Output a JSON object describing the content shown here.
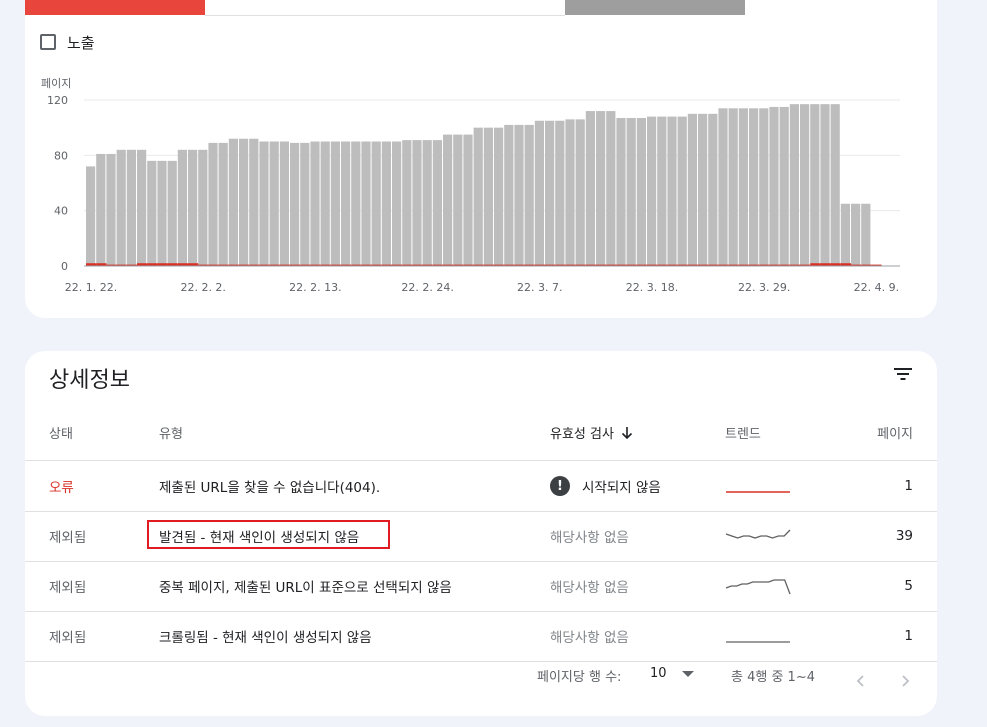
{
  "impressions_checkbox": {
    "label": "노출",
    "checked": false
  },
  "chart_data": {
    "type": "bar",
    "ylabel": "페이지",
    "ylim": [
      0,
      120
    ],
    "yticks": [
      "0",
      "40",
      "80",
      "120"
    ],
    "xtick_labels": [
      "22. 1. 22.",
      "22. 2. 2.",
      "22. 2. 13.",
      "22. 2. 24.",
      "22. 3. 7.",
      "22. 3. 18.",
      "22. 3. 29.",
      "22. 4. 9."
    ],
    "xtick_days": [
      0,
      11,
      22,
      33,
      44,
      55,
      66,
      77
    ],
    "series": [
      {
        "values": [
          72,
          81,
          81,
          84,
          84,
          84,
          76,
          76,
          76,
          84,
          84,
          84,
          89,
          89,
          92,
          92,
          92,
          90,
          90,
          90,
          89,
          89,
          90,
          90,
          90,
          90,
          90,
          90,
          90,
          90,
          90,
          91,
          91,
          91,
          91,
          95,
          95,
          95,
          100,
          100,
          100,
          102,
          102,
          102,
          105,
          105,
          105,
          106,
          106,
          112,
          112,
          112,
          107,
          107,
          107,
          108,
          108,
          108,
          108,
          110,
          110,
          110,
          114,
          114,
          114,
          114,
          114,
          115,
          115,
          117,
          117,
          117,
          117,
          117,
          45,
          45,
          45
        ]
      },
      {
        "values": [
          2,
          2,
          1,
          1,
          1,
          2,
          2,
          2,
          2,
          2,
          2,
          1,
          1,
          1,
          1,
          1,
          1,
          1,
          1,
          1,
          1,
          1,
          1,
          1,
          1,
          1,
          1,
          1,
          1,
          1,
          1,
          1,
          1,
          1,
          1,
          1,
          1,
          1,
          1,
          1,
          1,
          1,
          1,
          1,
          1,
          1,
          1,
          1,
          1,
          1,
          1,
          1,
          1,
          1,
          1,
          1,
          1,
          1,
          1,
          1,
          1,
          1,
          1,
          1,
          1,
          1,
          1,
          1,
          1,
          1,
          1,
          2,
          2,
          2,
          2,
          1,
          1,
          1
        ]
      }
    ],
    "colors": {
      "bar": "#bdbdbd",
      "error": "#d93025",
      "grid": "#e8eaed"
    }
  },
  "details": {
    "title": "상세정보",
    "headers": {
      "status": "상태",
      "type": "유형",
      "validation": "유효성 검사",
      "trend": "트렌드",
      "pages": "페이지"
    },
    "rows": [
      {
        "status": "오류",
        "type": "제출된 URL을 찾을 수 없습니다(404).",
        "validation": "시작되지 않음",
        "pages": "1",
        "trend": [
          1,
          1,
          1,
          1,
          1,
          1,
          1,
          1,
          1,
          1,
          1,
          1
        ],
        "trend_color": "#d93025"
      },
      {
        "status": "제외됨",
        "type": "발견됨 - 현재 색인이 생성되지 않음",
        "validation": "해당사항 없음",
        "pages": "39",
        "trend": [
          5,
          4,
          3,
          4,
          4,
          3,
          4,
          4,
          3,
          4,
          4,
          7
        ],
        "trend_color": "#616161"
      },
      {
        "status": "제외됨",
        "type": "중복 페이지, 제출된 URL이 표준으로 선택되지 않음",
        "validation": "해당사항 없음",
        "pages": "5",
        "trend": [
          3,
          4,
          4,
          5,
          5,
          6,
          6,
          6,
          6,
          7,
          7,
          7,
          0
        ],
        "trend_color": "#616161"
      },
      {
        "status": "제외됨",
        "type": "크롤링됨 - 현재 색인이 생성되지 않음",
        "validation": "해당사항 없음",
        "pages": "1",
        "trend": [
          1,
          1,
          1,
          1,
          1,
          1,
          1,
          1,
          1,
          1,
          1,
          1
        ],
        "trend_color": "#616161"
      }
    ]
  },
  "pagination": {
    "rows_per_page_label": "페이지당 행 수:",
    "rows_per_page": "10",
    "range_text": "총 4행 중 1~4"
  },
  "icons": {
    "sort": "arrow-down-icon",
    "filter": "filter-icon",
    "validation": "exclamation-icon",
    "prev": "chevron-left-icon",
    "next": "chevron-right-icon",
    "dropdown": "caret-down-icon"
  }
}
